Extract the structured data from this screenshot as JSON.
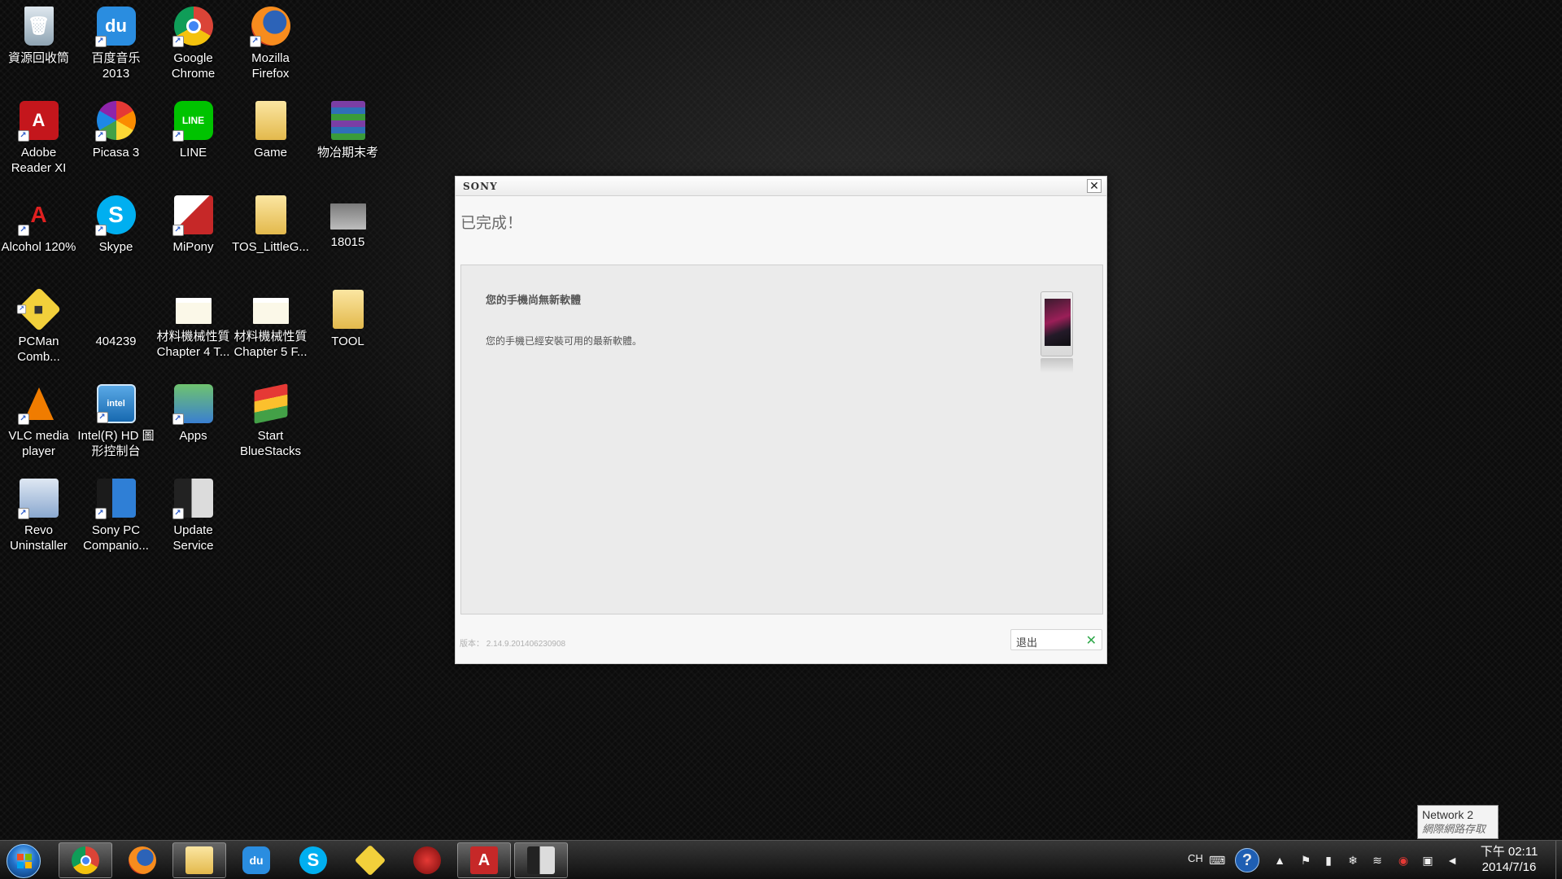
{
  "desktop": {
    "icons": [
      {
        "label": "資源回收筒",
        "icon": "recycle-bin-icon"
      },
      {
        "label": "百度音乐 2013",
        "icon": "baidu-music-icon"
      },
      {
        "label": "Google Chrome",
        "icon": "chrome-icon"
      },
      {
        "label": "Mozilla Firefox",
        "icon": "firefox-icon"
      },
      {
        "label": "Adobe Reader XI",
        "icon": "adobe-reader-icon"
      },
      {
        "label": "Picasa 3",
        "icon": "picasa-icon"
      },
      {
        "label": "LINE",
        "icon": "line-icon"
      },
      {
        "label": "Game",
        "icon": "folder-icon"
      },
      {
        "label": "物冶期末考",
        "icon": "winrar-icon"
      },
      {
        "label": "Alcohol 120%",
        "icon": "alcohol-icon"
      },
      {
        "label": "Skype",
        "icon": "skype-icon"
      },
      {
        "label": "MiPony",
        "icon": "mipony-icon"
      },
      {
        "label": "TOS_LittleG...",
        "icon": "folder-icon"
      },
      {
        "label": "18015",
        "icon": "image-file-icon"
      },
      {
        "label": "PCMan Comb...",
        "icon": "pcman-icon"
      },
      {
        "label": "404239",
        "icon": "image-file-icon"
      },
      {
        "label": "材料機械性質 Chapter 4 T...",
        "icon": "document-icon"
      },
      {
        "label": "材料機械性質 Chapter 5 F...",
        "icon": "document-icon"
      },
      {
        "label": "TOOL",
        "icon": "folder-icon"
      },
      {
        "label": "VLC media player",
        "icon": "vlc-icon"
      },
      {
        "label": "Intel(R) HD 圖形控制台",
        "icon": "intel-graphics-icon"
      },
      {
        "label": "Apps",
        "icon": "apps-icon"
      },
      {
        "label": "Start BlueStacks",
        "icon": "bluestacks-icon"
      },
      {
        "label": "Revo Uninstaller",
        "icon": "revo-uninstaller-icon"
      },
      {
        "label": "Sony PC Companio...",
        "icon": "sony-pc-companion-icon"
      },
      {
        "label": "Update Service",
        "icon": "update-service-icon"
      }
    ]
  },
  "dialog": {
    "brand": "SONY",
    "close_glyph": "✕",
    "heading": "已完成！",
    "panel_title": "您的手機尚無新軟體",
    "panel_message": "您的手機已經安裝可用的最新軟體。",
    "version": "版本： 2.14.9.201406230908",
    "exit_label": "退出",
    "exit_glyph": "✕"
  },
  "tooltip": {
    "line1": "Network  2",
    "line2": "網際網路存取"
  },
  "taskbar": {
    "items": [
      {
        "icon": "chrome-icon",
        "active": true
      },
      {
        "icon": "firefox-icon",
        "active": false
      },
      {
        "icon": "file-explorer-icon",
        "active": true
      },
      {
        "icon": "baidu-music-icon",
        "active": false
      },
      {
        "icon": "skype-icon",
        "active": false
      },
      {
        "icon": "pcman-icon",
        "active": false
      },
      {
        "icon": "red-app-icon",
        "active": false
      },
      {
        "icon": "autocad-icon",
        "active": true
      },
      {
        "icon": "update-service-icon",
        "active": true
      }
    ],
    "language": "CH",
    "clock_ampm_time": "下午 02:11",
    "clock_date": "2014/7/16"
  },
  "colors": {
    "sony_exit_x": "#2fa84a",
    "chrome": "#db4437",
    "skype": "#00aff0",
    "line": "#00c300",
    "adobe": "#c4161c"
  }
}
